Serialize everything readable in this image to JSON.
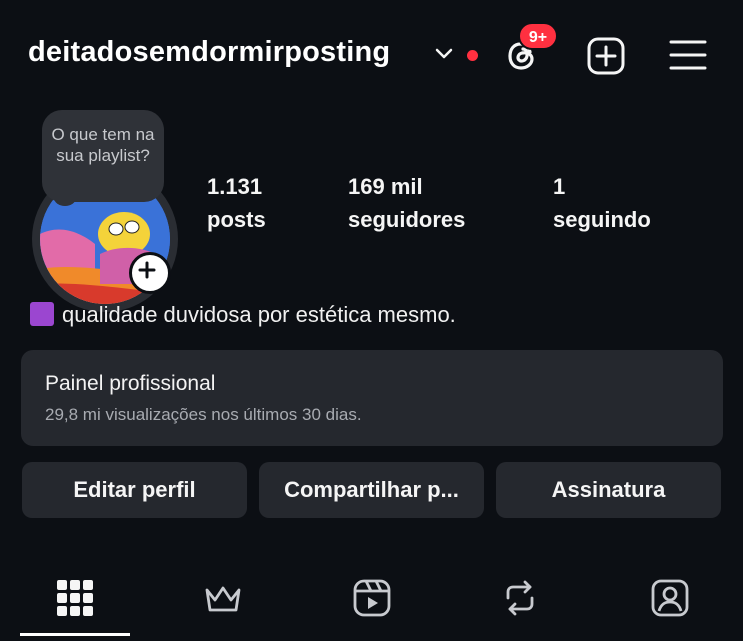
{
  "header": {
    "username": "deitadosemdormirposting",
    "notification_badge": "9+",
    "accent_red": "#ff3040",
    "icons": [
      "chevron-down-icon",
      "threads-icon",
      "add-post-icon",
      "menu-icon"
    ]
  },
  "profile": {
    "note": "O que tem na sua playlist?",
    "stats": [
      {
        "value": "1.131",
        "label": "posts"
      },
      {
        "value": "169 mil",
        "label": "seguidores"
      },
      {
        "value": "1",
        "label": "seguindo"
      }
    ],
    "bio": "qualidade duvidosa por estética mesmo."
  },
  "panel": {
    "title": "Painel profissional",
    "subtitle": "29,8 mi visualizações nos últimos 30 dias."
  },
  "buttons": {
    "edit": "Editar perfil",
    "share": "Compartilhar p...",
    "subscription": "Assinatura"
  },
  "tabs": [
    "grid-icon",
    "crown-icon",
    "reels-icon",
    "reposts-icon",
    "tagged-icon"
  ]
}
